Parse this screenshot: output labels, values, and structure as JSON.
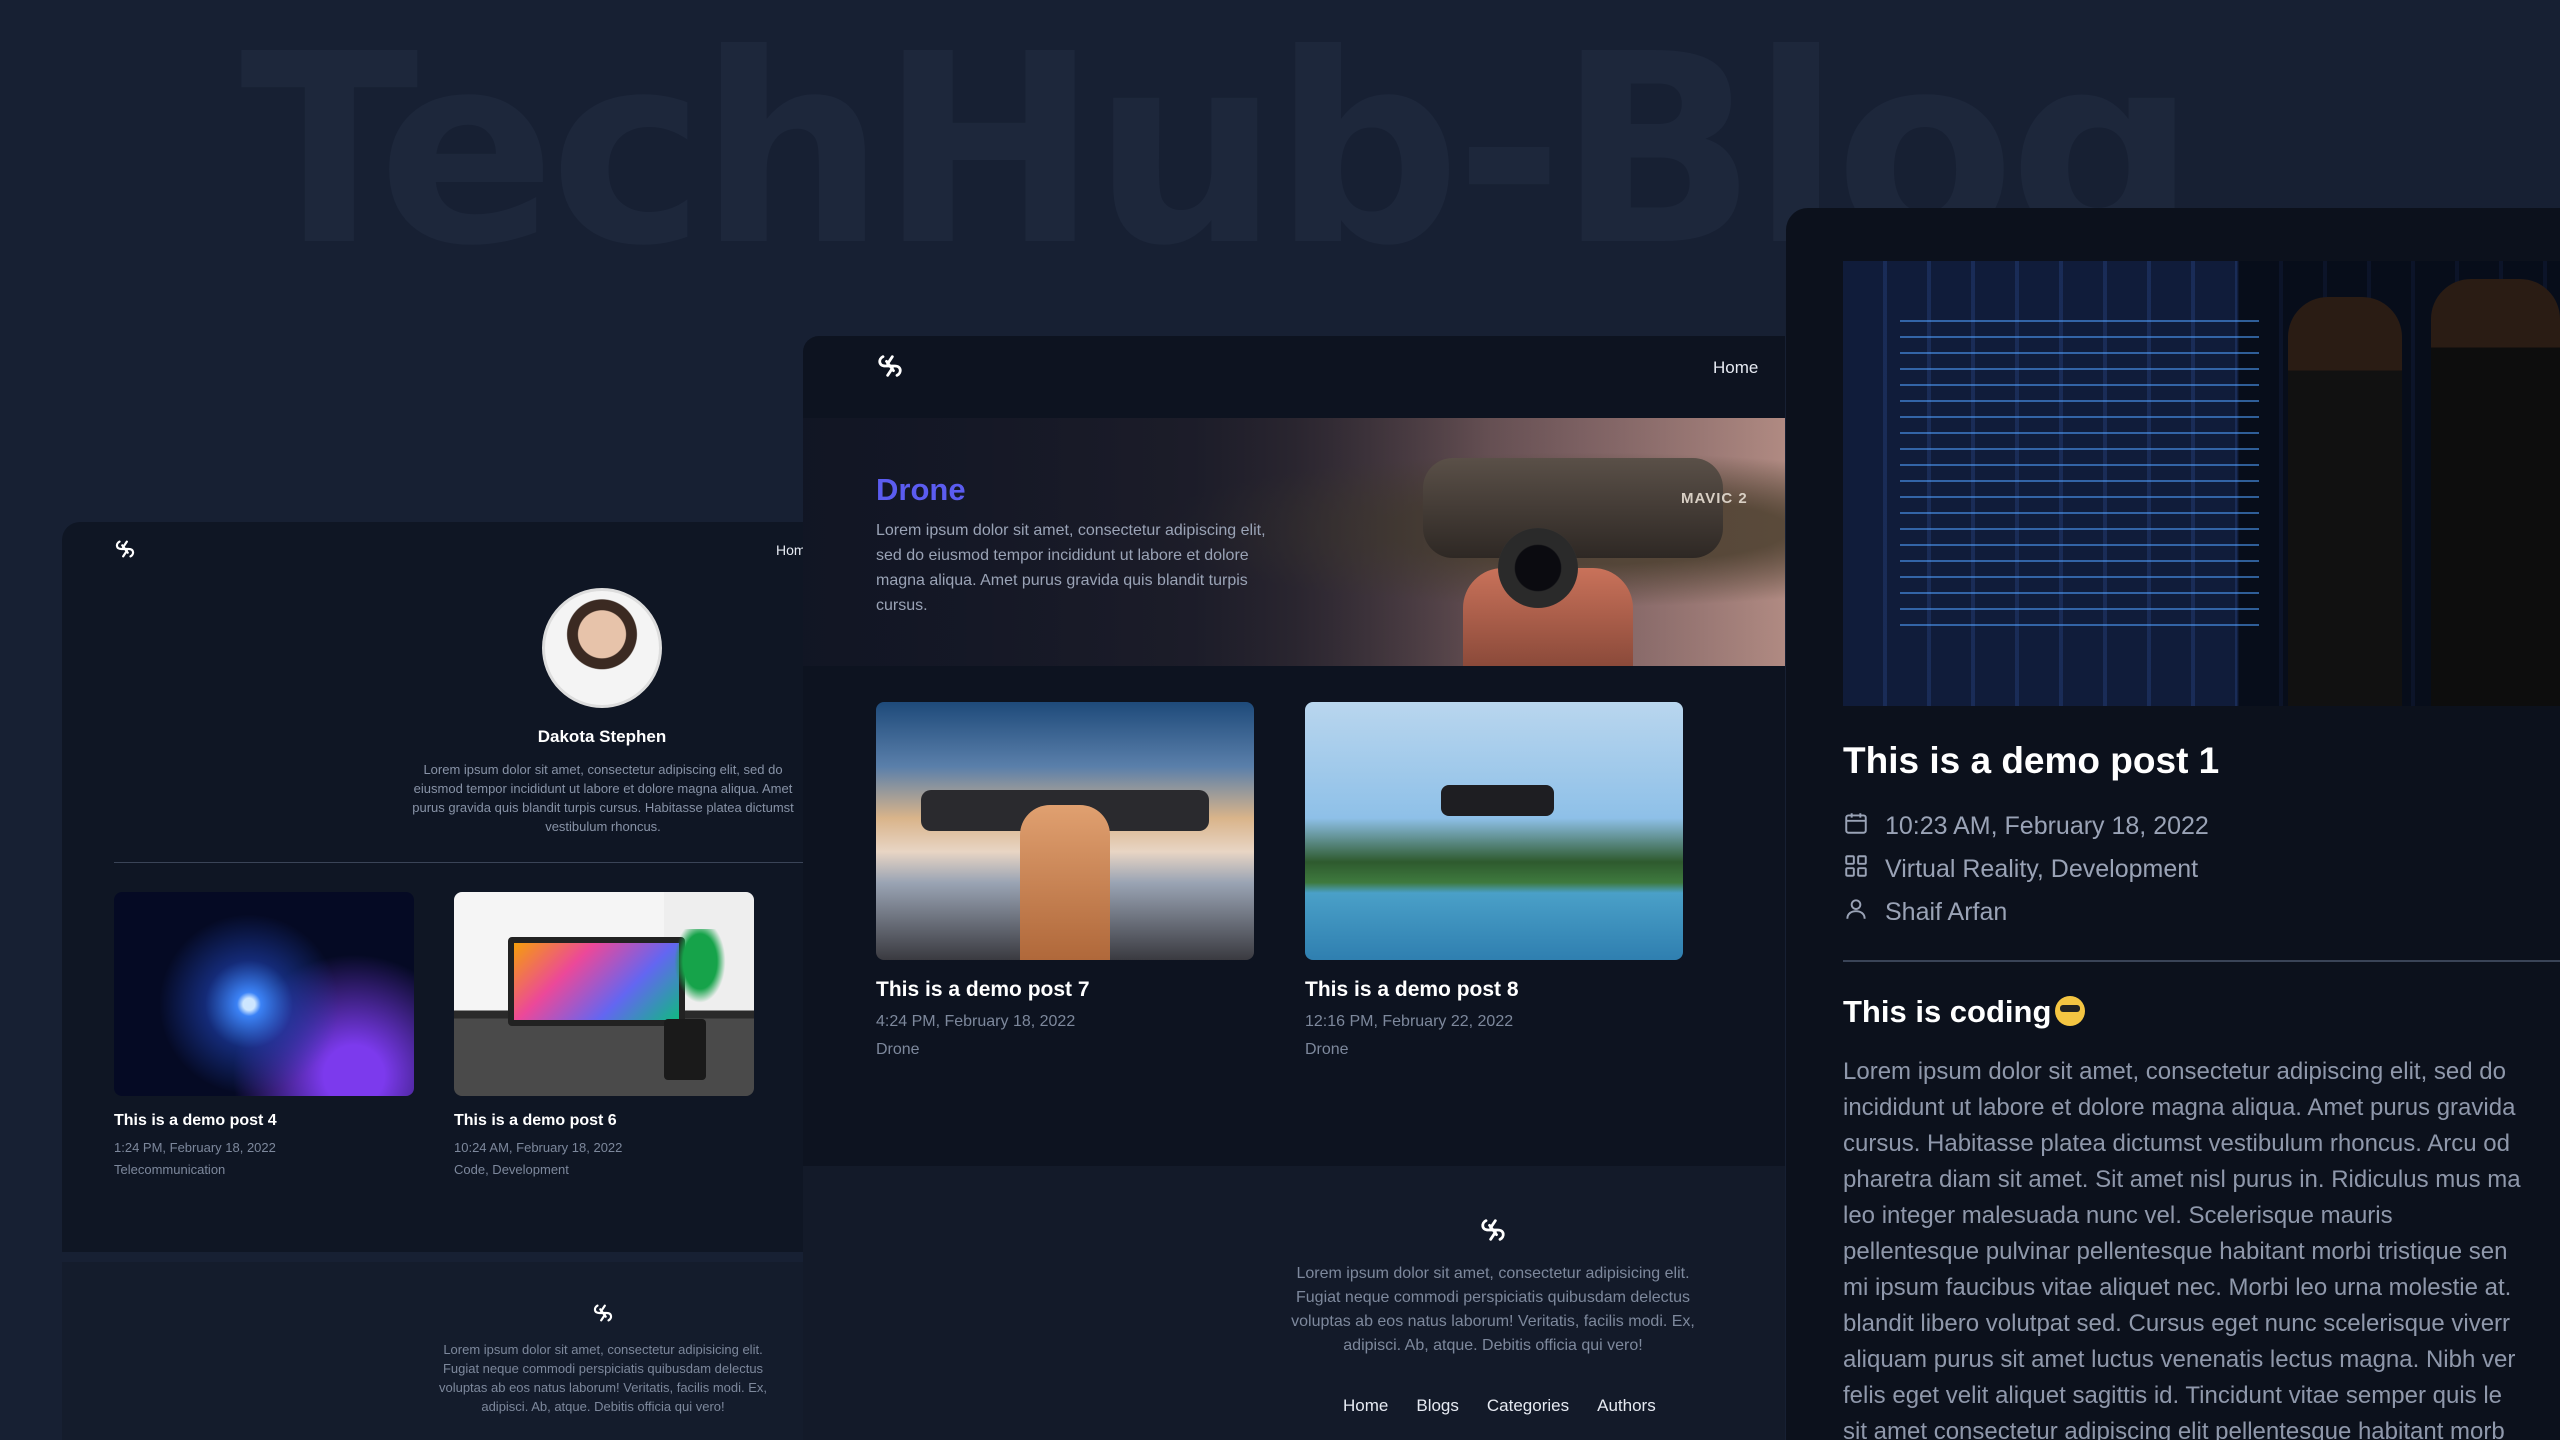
{
  "background": {
    "watermark_text": "TechHub-Blog"
  },
  "left_panel": {
    "nav_home": "Hom",
    "author": {
      "name": "Dakota Stephen",
      "bio": "Lorem ipsum dolor sit amet, consectetur adipiscing elit, sed do eiusmod tempor incididunt ut labore et dolore magna aliqua. Amet purus gravida quis blandit turpis cursus. Habitasse platea dictumst vestibulum rhoncus."
    },
    "posts": [
      {
        "title": "This is a demo post 4",
        "date": "1:24 PM, February 18, 2022",
        "categories": "Telecommunication"
      },
      {
        "title": "This is a demo post 6",
        "date": "10:24 AM, February 18, 2022",
        "categories": "Code, Development"
      }
    ],
    "footer": {
      "text": "Lorem ipsum dolor sit amet, consectetur adipisicing elit. Fugiat neque commodi perspiciatis quibusdam delectus voluptas ab eos natus laborum! Veritatis, facilis modi. Ex, adipisci. Ab, atque. Debitis officia qui vero!"
    }
  },
  "mid_panel": {
    "nav_home": "Home",
    "hero": {
      "title": "Drone",
      "text": "Lorem ipsum dolor sit amet, consectetur adipiscing elit, sed do eiusmod tempor incididunt ut labore et dolore magna aliqua. Amet purus gravida quis blandit turpis cursus.",
      "product_label": "MAVIC 2"
    },
    "posts": [
      {
        "title": "This is a demo post 7",
        "date": "4:24 PM, February 18, 2022",
        "categories": "Drone"
      },
      {
        "title": "This is a demo post 8",
        "date": "12:16 PM, February 22, 2022",
        "categories": "Drone"
      }
    ],
    "footer": {
      "text": "Lorem ipsum dolor sit amet, consectetur adipisicing elit. Fugiat neque commodi perspiciatis quibusdam delectus voluptas ab eos natus laborum! Veritatis, facilis modi. Ex, adipisci. Ab, atque. Debitis officia qui vero!",
      "nav": [
        "Home",
        "Blogs",
        "Categories",
        "Authors"
      ]
    }
  },
  "right_panel": {
    "title": "This is a demo post 1",
    "meta": {
      "date": "10:23 AM, February 18, 2022",
      "categories": "Virtual Reality, Development",
      "author": "Shaif Arfan"
    },
    "section_title": "This is coding",
    "body": "Lorem ipsum dolor sit amet, consectetur adipiscing elit, sed do\nincididunt ut labore et dolore magna aliqua. Amet purus gravida\ncursus. Habitasse platea dictumst vestibulum rhoncus. Arcu od\npharetra diam sit amet. Sit amet nisl purus in. Ridiculus mus ma\nleo integer malesuada nunc vel. Scelerisque mauris\npellentesque pulvinar pellentesque habitant morbi tristique sen\nmi ipsum faucibus vitae aliquet nec. Morbi leo urna molestie at.\nblandit libero volutpat sed. Cursus eget nunc scelerisque viverr\naliquam purus sit amet luctus venenatis lectus magna. Nibh ver\nfelis eget velit aliquet sagittis id. Tincidunt vitae semper quis le\nsit amet consectetur adipiscing elit pellentesque habitant morb"
  },
  "colors": {
    "page_background": "#172033",
    "accent": "#5b5cf0",
    "panel": "#0f1624"
  },
  "icons": [
    "logo-icon",
    "calendar-icon",
    "grid-icon",
    "user-icon",
    "smiling-sunglasses-emoji-icon"
  ]
}
